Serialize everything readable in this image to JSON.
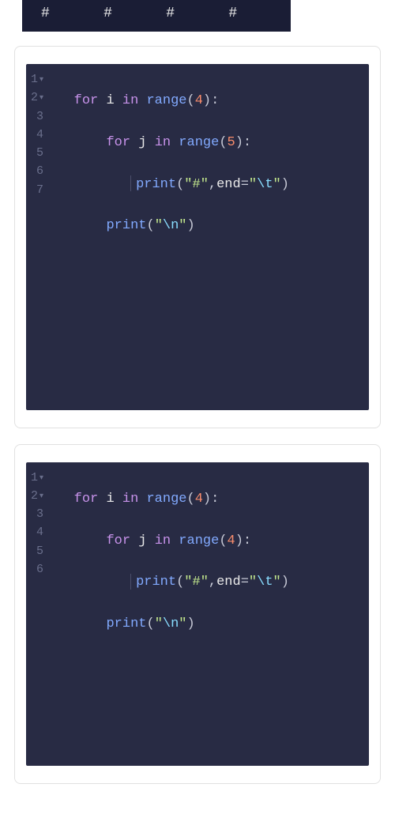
{
  "output": {
    "line": "#      #      #      #"
  },
  "options": [
    {
      "gutter": [
        "1",
        "2",
        "3",
        "4",
        "5",
        "6",
        "7"
      ],
      "fold_on": [
        0,
        1
      ],
      "code": {
        "kw_for": "for",
        "kw_in": "in",
        "var_i": "i",
        "var_j": "j",
        "fn_range": "range",
        "fn_print": "print",
        "outer_n": "4",
        "inner_n": "5",
        "hash_str": "\"#\"",
        "end_kw": "end",
        "tab_open": "\"",
        "tab_esc": "\\t",
        "tab_close": "\"",
        "nl_open": "\"",
        "nl_esc": "\\n",
        "nl_close": "\""
      }
    },
    {
      "gutter": [
        "1",
        "2",
        "3",
        "4",
        "5",
        "6"
      ],
      "fold_on": [
        0,
        1
      ],
      "code": {
        "kw_for": "for",
        "kw_in": "in",
        "var_i": "i",
        "var_j": "j",
        "fn_range": "range",
        "fn_print": "print",
        "outer_n": "4",
        "inner_n": "4",
        "hash_str": "\"#\"",
        "end_kw": "end",
        "tab_open": "\"",
        "tab_esc": "\\t",
        "tab_close": "\"",
        "nl_open": "\"",
        "nl_esc": "\\n",
        "nl_close": "\""
      }
    }
  ]
}
